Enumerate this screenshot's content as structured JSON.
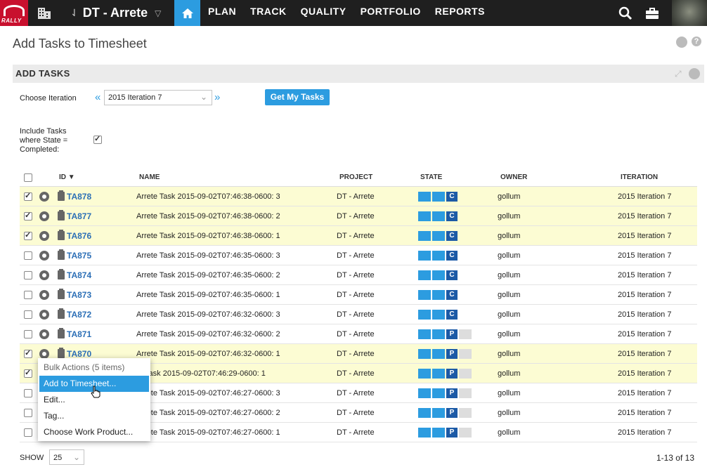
{
  "app": {
    "logo_text": "RALLY",
    "project": "DT - Arrete",
    "nav": [
      "PLAN",
      "TRACK",
      "QUALITY",
      "PORTFOLIO",
      "REPORTS"
    ]
  },
  "page": {
    "title": "Add Tasks to Timesheet"
  },
  "panel": {
    "title": "ADD TASKS",
    "iteration_label": "Choose Iteration",
    "iteration_value": "2015 Iteration 7",
    "prev": "«",
    "next": "»",
    "get_button": "Get My Tasks",
    "include_label": "Include Tasks where State = Completed:",
    "include_checked": true
  },
  "grid": {
    "columns": [
      "ID ▼",
      "NAME",
      "PROJECT",
      "STATE",
      "OWNER",
      "ITERATION"
    ],
    "rows": [
      {
        "id": "TA878",
        "name": "Arrete Task 2015-09-02T07:46:38-0600: 3",
        "project": "DT - Arrete",
        "state": "C",
        "owner": "gollum",
        "iteration": "2015 Iteration 7",
        "checked": true
      },
      {
        "id": "TA877",
        "name": "Arrete Task 2015-09-02T07:46:38-0600: 2",
        "project": "DT - Arrete",
        "state": "C",
        "owner": "gollum",
        "iteration": "2015 Iteration 7",
        "checked": true
      },
      {
        "id": "TA876",
        "name": "Arrete Task 2015-09-02T07:46:38-0600: 1",
        "project": "DT - Arrete",
        "state": "C",
        "owner": "gollum",
        "iteration": "2015 Iteration 7",
        "checked": true
      },
      {
        "id": "TA875",
        "name": "Arrete Task 2015-09-02T07:46:35-0600: 3",
        "project": "DT - Arrete",
        "state": "C",
        "owner": "gollum",
        "iteration": "2015 Iteration 7",
        "checked": false
      },
      {
        "id": "TA874",
        "name": "Arrete Task 2015-09-02T07:46:35-0600: 2",
        "project": "DT - Arrete",
        "state": "C",
        "owner": "gollum",
        "iteration": "2015 Iteration 7",
        "checked": false
      },
      {
        "id": "TA873",
        "name": "Arrete Task 2015-09-02T07:46:35-0600: 1",
        "project": "DT - Arrete",
        "state": "C",
        "owner": "gollum",
        "iteration": "2015 Iteration 7",
        "checked": false
      },
      {
        "id": "TA872",
        "name": "Arrete Task 2015-09-02T07:46:32-0600: 3",
        "project": "DT - Arrete",
        "state": "C",
        "owner": "gollum",
        "iteration": "2015 Iteration 7",
        "checked": false
      },
      {
        "id": "TA871",
        "name": "Arrete Task 2015-09-02T07:46:32-0600: 2",
        "project": "DT - Arrete",
        "state": "P",
        "owner": "gollum",
        "iteration": "2015 Iteration 7",
        "checked": false
      },
      {
        "id": "TA870",
        "name": "Arrete Task 2015-09-02T07:46:32-0600: 1",
        "project": "DT - Arrete",
        "state": "P",
        "owner": "gollum",
        "iteration": "2015 Iteration 7",
        "checked": true
      },
      {
        "id": "",
        "name": "te Task 2015-09-02T07:46:29-0600: 1",
        "project": "DT - Arrete",
        "state": "P",
        "owner": "gollum",
        "iteration": "2015 Iteration 7",
        "checked": true
      },
      {
        "id": "",
        "name": "Arrete Task 2015-09-02T07:46:27-0600: 3",
        "project": "DT - Arrete",
        "state": "P",
        "owner": "gollum",
        "iteration": "2015 Iteration 7",
        "checked": false
      },
      {
        "id": "",
        "name": "Arrete Task 2015-09-02T07:46:27-0600: 2",
        "project": "DT - Arrete",
        "state": "P",
        "owner": "gollum",
        "iteration": "2015 Iteration 7",
        "checked": false
      },
      {
        "id": "",
        "name": "Arrete Task 2015-09-02T07:46:27-0600: 1",
        "project": "DT - Arrete",
        "state": "P",
        "owner": "gollum",
        "iteration": "2015 Iteration 7",
        "checked": false
      }
    ]
  },
  "context_menu": {
    "title": "Bulk Actions (5 items)",
    "items": [
      "Add to Timesheet...",
      "Edit...",
      "Tag...",
      "Choose Work Product..."
    ]
  },
  "footer": {
    "show_label": "SHOW",
    "page_size": "25",
    "pager": "1-13 of 13"
  },
  "colors": {
    "accent": "#2c9ce0",
    "selected_row": "#fcfcd3",
    "topbar": "#1f1f1f"
  }
}
